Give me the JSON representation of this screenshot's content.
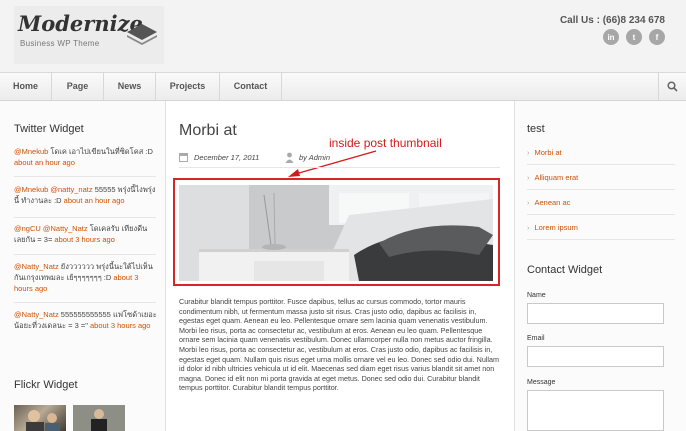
{
  "header": {
    "logo_title": "Modernize",
    "logo_subtitle": "Business WP Theme",
    "call_us": "Call Us : (66)8 234 678",
    "social": [
      {
        "icon": "linkedin-icon",
        "glyph": "in"
      },
      {
        "icon": "twitter-icon",
        "glyph": "t"
      },
      {
        "icon": "facebook-icon",
        "glyph": "f"
      }
    ]
  },
  "nav": {
    "items": [
      "Home",
      "Page",
      "News",
      "Projects",
      "Contact"
    ],
    "search_icon": "search-icon"
  },
  "left_sidebar": {
    "twitter_title": "Twitter Widget",
    "tweets": [
      {
        "user": "@Mnekub",
        "text": " โดเค เอาไปเขียนในที่ซิดโคส :D ",
        "time": "about an hour ago"
      },
      {
        "user": "@Mnekub",
        "mention": "@natty_natz",
        "text": " 55555 พรุ่งนี้ไงพรุ่งนี้ ทำงานละ :D ",
        "time": "about an hour ago"
      },
      {
        "user": "@ngCU",
        "mention": "@Natty_Natz",
        "text": " โดเคลรับ เทียงดีนเลยกัน = 3= ",
        "time": "about 3 hours ago"
      },
      {
        "user": "@Natty_Natz",
        "text": " ยังวววววว พรุ่งนี้นะใต้ไปเห็นกันเกรุงเทพมละ เย้ๆๆๆๆๆๆๆ :D ",
        "time": "about 3 hours ago"
      },
      {
        "user": "@Natty_Natz",
        "text": " 555555555555 แฟโซด้าเยอะน้อยะที่วงเดลนะ = 3 =\" ",
        "time": "about 3 hours ago"
      }
    ],
    "flickr_title": "Flickr Widget"
  },
  "post": {
    "title": "Morbi at",
    "date": "December 17, 2011",
    "author": "by Admin",
    "annotation": "inside post thumbnail",
    "body": "Curabitur blandit tempus porttitor. Fusce dapibus, tellus ac cursus commodo, tortor mauris condimentum nibh, ut fermentum massa justo sit risus. Cras justo odio, dapibus ac facilisis in, egestas eget quam. Aenean eu leo. Pellentesque ornare sem lacinia quam venenatis vestibulum. Morbi leo risus, porta ac consectetur ac, vestibulum at eros. Aenean eu leo quam. Pellentesque ornare sem lacinia quam venenatis vestibulum. Donec ullamcorper nulla non metus auctor fringilla. Morbi leo risus, porta ac consectetur ac, vestibulum at eros. Cras justo odio, dapibus ac facilisis in, egestas eget quam. Nullam quis risus eget urna mollis ornare vel eu leo. Donec sed odio dui. Nullam id dolor id nibh ultricies vehicula ut id elit. Maecenas sed diam eget risus varius blandit sit amet non magna. Donec id elit non mi porta gravida at eget metus. Donec sed odio dui. Curabitur blandit tempus porttitor. Curabitur blandit tempus porttitor."
  },
  "right_sidebar": {
    "list_title": "test",
    "links": [
      "Morbi at",
      "Alliquam erat",
      "Aenean ac",
      "Lorem ipsum"
    ],
    "contact_title": "Contact Widget",
    "fields": [
      "Name",
      "Email",
      "Message"
    ]
  },
  "colors": {
    "accent": "#d15000",
    "annotation": "#d41a1a"
  }
}
